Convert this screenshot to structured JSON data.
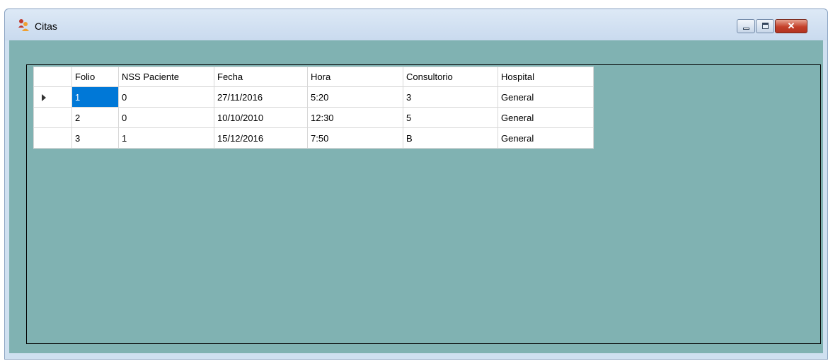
{
  "window": {
    "title": "Citas"
  },
  "table": {
    "columns": [
      "Folio",
      "NSS Paciente",
      "Fecha",
      "Hora",
      "Consultorio",
      "Hospital"
    ],
    "rows": [
      [
        "1",
        "0",
        "27/11/2016",
        "5:20",
        "3",
        "General"
      ],
      [
        "2",
        "0",
        "10/10/2010",
        "12:30",
        "5",
        "General"
      ],
      [
        "3",
        "1",
        "15/12/2016",
        "7:50",
        "B",
        "General"
      ]
    ],
    "selected_row": 0,
    "selected_cell": "Folio"
  },
  "colors": {
    "client_background": "#80b2b2",
    "selection": "#0078d7"
  },
  "icons": {
    "app": "people-icon",
    "current_row": "row-pointer-arrow-icon"
  }
}
